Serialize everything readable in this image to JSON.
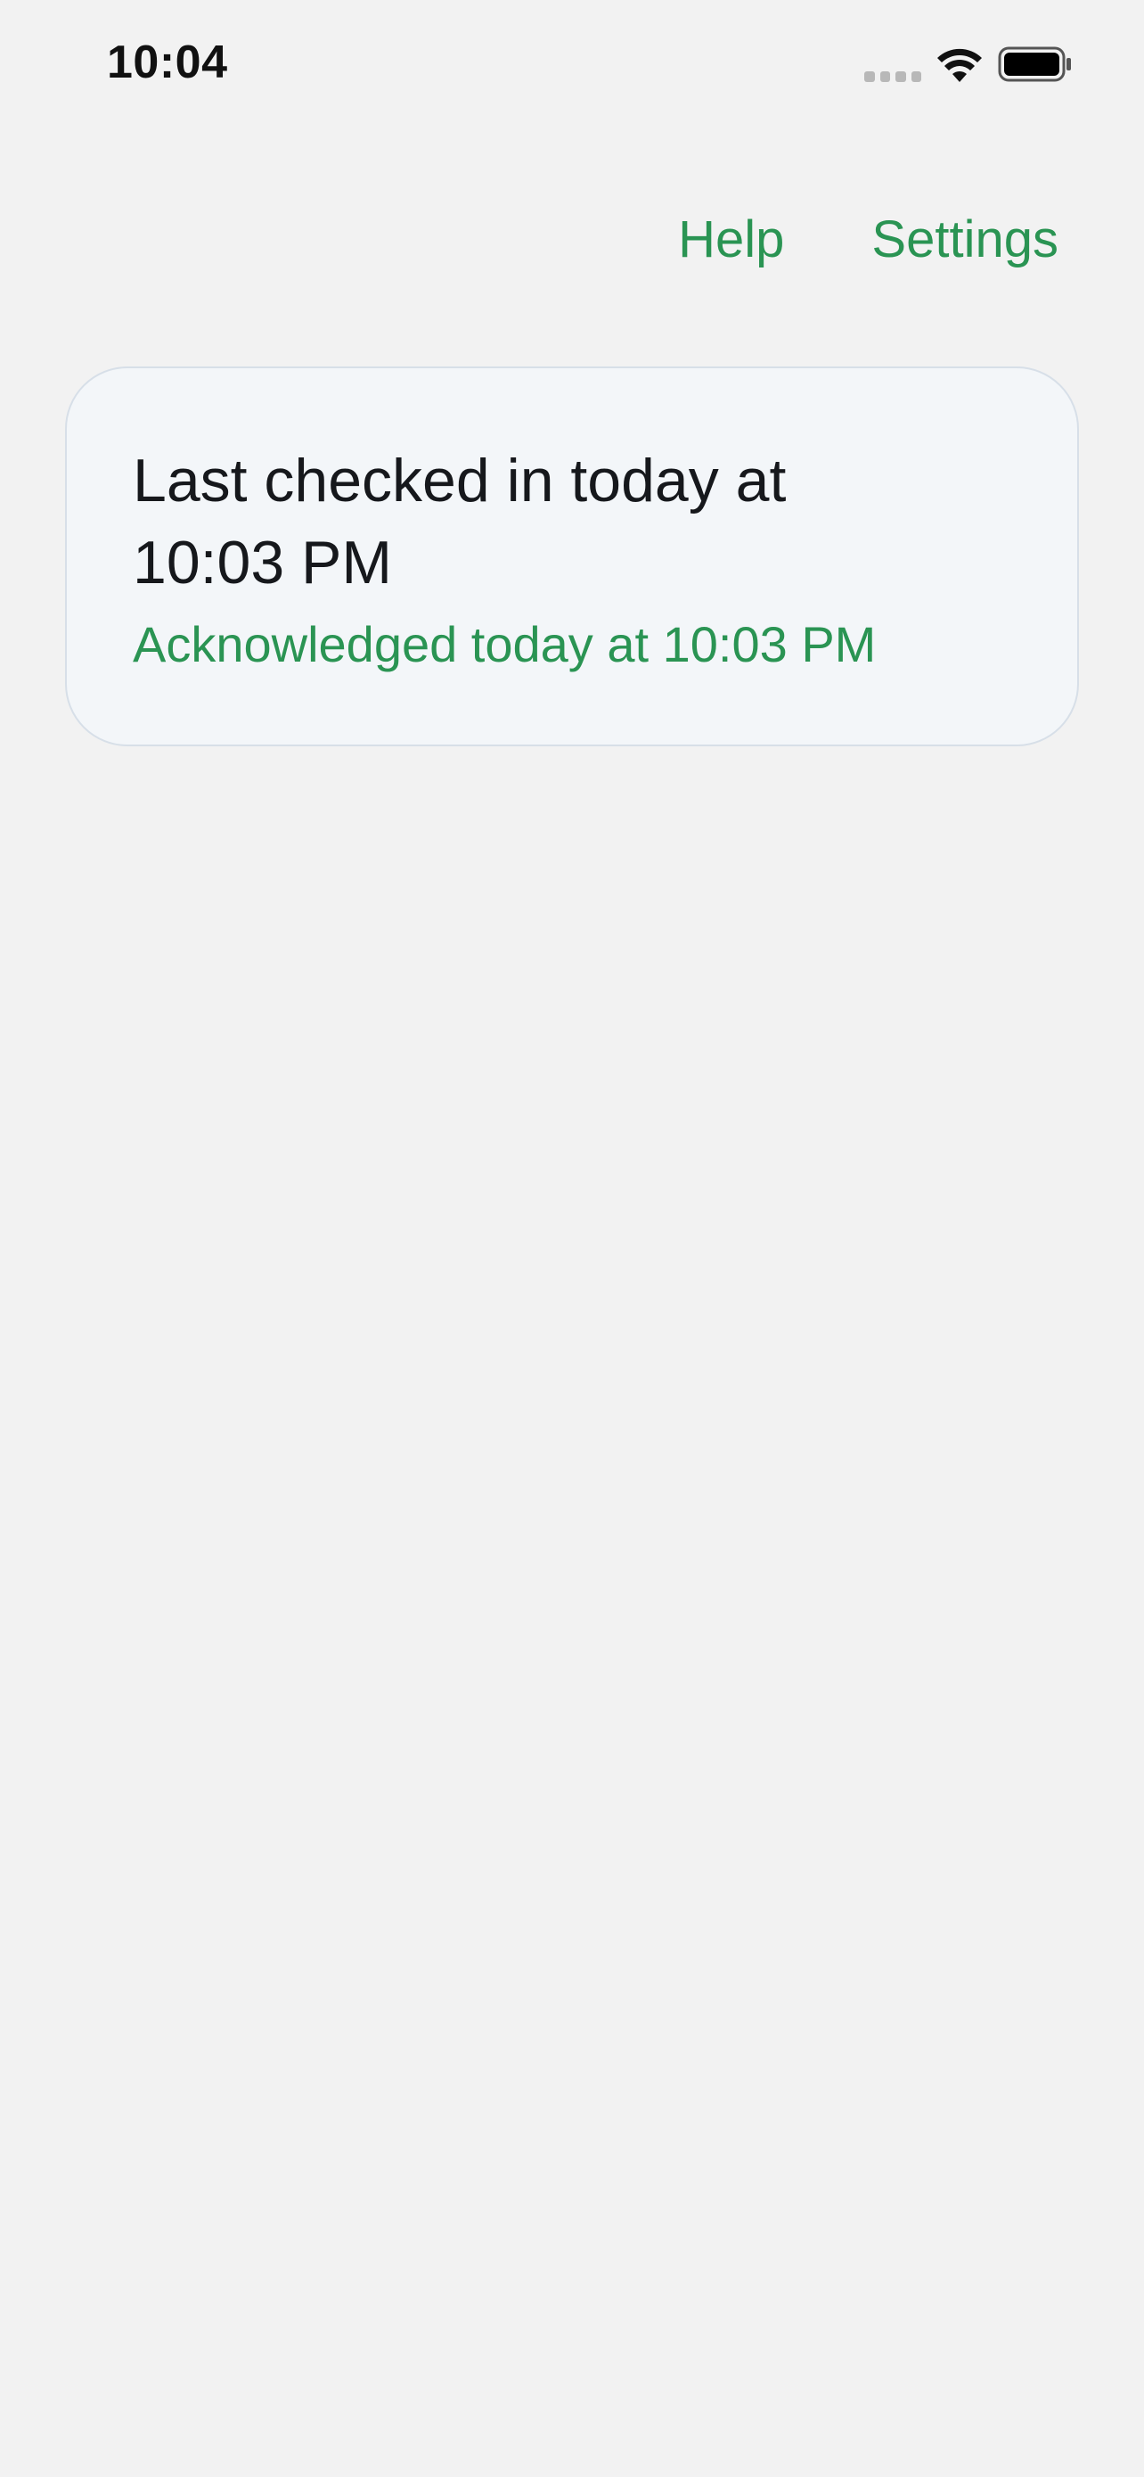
{
  "status_bar": {
    "time": "10:04",
    "icons": [
      "cellular-signal-icon",
      "wifi-icon",
      "battery-icon"
    ]
  },
  "nav": {
    "help_label": "Help",
    "settings_label": "Settings"
  },
  "card": {
    "title": "Last checked in today at 10:03 PM",
    "subtitle": "Acknowledged today at 10:03 PM"
  },
  "colors": {
    "accent": "#2a9453",
    "background": "#f2f2f2",
    "card_background": "#f3f6f9",
    "card_border": "#d7dfe8",
    "text_primary": "#16181c"
  }
}
